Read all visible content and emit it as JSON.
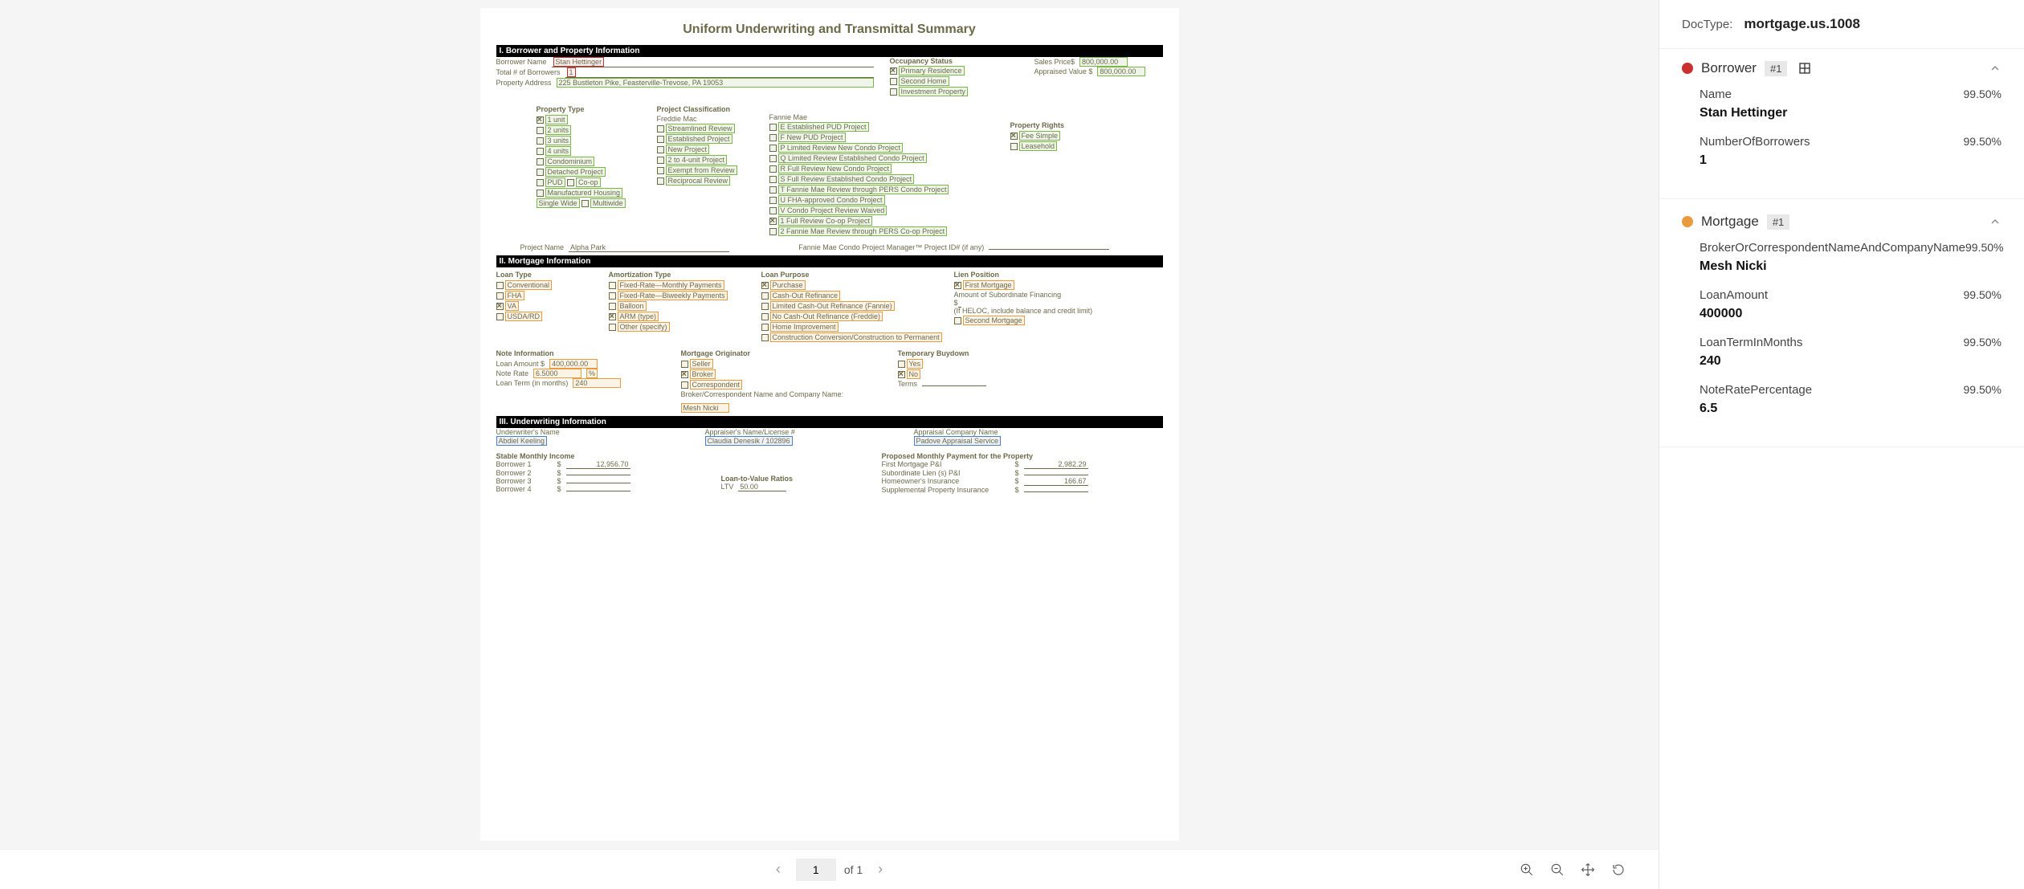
{
  "document": {
    "title": "Uniform Underwriting and Transmittal Summary",
    "section1": {
      "header": "I. Borrower and Property Information",
      "borrower_name_label": "Borrower Name",
      "borrower_name": "Stan Hettinger",
      "total_borrowers_label": "Total # of Borrowers",
      "total_borrowers": "1",
      "property_address_label": "Property Address",
      "property_address": "225 Bustleton Pike, Feasterville-Trevose, PA 19053",
      "occupancy_label": "Occupancy Status",
      "occupancy_items": [
        "Primary Residence",
        "Second Home",
        "Investment Property"
      ],
      "sales_price_label": "Sales Price$",
      "sales_price": "800,000.00",
      "appraised_label": "Appraised Value $",
      "appraised": "800,000.00",
      "property_type_label": "Property Type",
      "property_type_items": [
        "1 unit",
        "2 units",
        "3 units",
        "4 units",
        "Condominium",
        "Detached Project"
      ],
      "pud_label": "PUD",
      "coop_label": "Co-op",
      "mfg_housing": "Manufactured Housing",
      "single_wide": "Single Wide",
      "multiwide": "Multiwide",
      "project_class_label": "Project Classification",
      "freddie_label": "Freddie Mac",
      "freddie_items": [
        "Streamlined Review",
        "Established Project",
        "New Project",
        "2 to 4-unit Project",
        "Exempt from Review",
        "Reciprocal Review"
      ],
      "fannie_label": "Fannie Mae",
      "fannie_items": [
        "E Established PUD Project",
        "F New PUD Project",
        "P Limited Review New Condo Project",
        "Q Limited Review Established Condo Project",
        "R Full Review New Condo Project",
        "S Full Review Established Condo Project",
        "T Fannie Mae Review through PERS Condo Project",
        "U FHA-approved Condo Project",
        "V Condo Project Review Waived",
        "1 Full Review Co-op Project",
        "2 Fannie Mae Review through PERS Co-op Project"
      ],
      "property_rights_label": "Property Rights",
      "fee_simple": "Fee Simple",
      "leasehold": "Leasehold",
      "project_name_label": "Project Name",
      "project_name": "Alpha Park",
      "fannie_pm_label": "Fannie Mae Condo Project Manager™ Project ID# (if any)"
    },
    "section2": {
      "header": "II. Mortgage Information",
      "loan_type_label": "Loan Type",
      "loan_type_items": [
        "Conventional",
        "FHA",
        "VA",
        "USDA/RD"
      ],
      "amort_label": "Amortization Type",
      "amort_items": [
        "Fixed-Rate—Monthly Payments",
        "Fixed-Rate—Biweekly Payments",
        "Balloon",
        "ARM (type)",
        "Other (specify)"
      ],
      "loan_purpose_label": "Loan Purpose",
      "loan_purpose_items": [
        "Purchase",
        "Cash-Out Refinance",
        "Limited Cash-Out Refinance (Fannie)",
        "No Cash-Out Refinance (Freddie)",
        "Home Improvement",
        "Construction Conversion/Construction to Permanent"
      ],
      "lien_label": "Lien Position",
      "first_mortgage": "First Mortgage",
      "subordinate_label": "Amount of Subordinate Financing",
      "heloc_note": "(If HELOC, include balance and credit limit)",
      "second_mortgage": "Second Mortgage",
      "note_info_label": "Note Information",
      "loan_amount_label": "Loan Amount $",
      "loan_amount": "400,000.00",
      "note_rate_label": "Note Rate",
      "note_rate": "6.5000",
      "note_rate_pct": "%",
      "loan_term_label": "Loan Term (in months)",
      "loan_term": "240",
      "mortgage_orig_label": "Mortgage Originator",
      "seller": "Seller",
      "broker": "Broker",
      "correspondent": "Correspondent",
      "broker_company_label": "Broker/Correspondent Name and Company Name:",
      "broker_company": "Mesh Nicki",
      "temp_buydown_label": "Temporary Buydown",
      "yes": "Yes",
      "no": "No",
      "terms_label": "Terms"
    },
    "section3": {
      "header": "III. Underwriting Information",
      "underwriter_label": "Underwriter's Name",
      "underwriter": "Abdiel Keeling",
      "appraiser_label": "Appraiser's Name/License #",
      "appraiser": "Claudia Denesik / 102896",
      "appraisal_co_label": "Appraisal Company Name",
      "appraisal_co": "Padove Appraisal Service",
      "stable_income_label": "Stable Monthly Income",
      "borrower1": "Borrower 1",
      "borrower2": "Borrower 2",
      "borrower3": "Borrower 3",
      "borrower4": "Borrower 4",
      "b1_amount": "12,956.70",
      "ltv_label": "Loan-to-Value Ratios",
      "ltv_text": "LTV",
      "ltv_value": "50.00",
      "proposed_label": "Proposed Monthly Payment for the Property",
      "first_pi": "First Mortgage P&I",
      "sub_lien": "Subordinate Lien (s) P&I",
      "homeowners": "Homeowner's Insurance",
      "supp": "Supplemental Property Insurance",
      "first_pi_amount": "2,982.29",
      "homeowners_amount": "166.67"
    }
  },
  "toolbar": {
    "page_current": "1",
    "page_of": "of 1"
  },
  "sidebar": {
    "doctype_label": "DocType:",
    "doctype_value": "mortgage.us.1008",
    "entities": [
      {
        "color": "red",
        "name": "Borrower",
        "badge": "#1",
        "show_table_icon": true,
        "fields": [
          {
            "name": "Name",
            "conf": "99.50%",
            "value": "Stan Hettinger"
          },
          {
            "name": "NumberOfBorrowers",
            "conf": "99.50%",
            "value": "1"
          }
        ]
      },
      {
        "color": "orange",
        "name": "Mortgage",
        "badge": "#1",
        "show_table_icon": false,
        "fields": [
          {
            "name": "BrokerOrCorrespondentNameAndCompanyName",
            "conf": "99.50%",
            "value": "Mesh Nicki"
          },
          {
            "name": "LoanAmount",
            "conf": "99.50%",
            "value": "400000"
          },
          {
            "name": "LoanTermInMonths",
            "conf": "99.50%",
            "value": "240"
          },
          {
            "name": "NoteRatePercentage",
            "conf": "99.50%",
            "value": "6.5"
          }
        ]
      }
    ]
  }
}
